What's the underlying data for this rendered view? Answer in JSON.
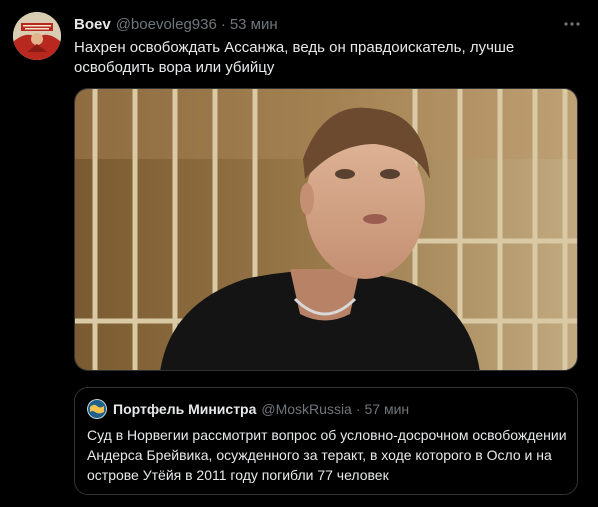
{
  "tweet": {
    "display_name": "Boev",
    "handle": "@boevoleg936",
    "separator": "·",
    "time": "53 мин",
    "text": "Нахрен освобождать Ассанжа, ведь он правдоискатель, лучше освободить вора или убийцу",
    "avatar_icon": "poster-avatar-icon",
    "media_icon": "photo-man-behind-bars"
  },
  "quote": {
    "display_name": "Портфель Министра",
    "handle": "@MoskRussia",
    "separator": "·",
    "time": "57 мин",
    "text": "Суд в Норвегии рассмотрит вопрос об условно-досрочном освобождении Андерса Брейвика, осужденного за теракт, в ходе которого в Осло и на острове Утёйя в 2011 году погибли 77 человек",
    "avatar_icon": "globe-avatar-icon"
  },
  "colors": {
    "background": "#000000",
    "text_primary": "#e7e9ea",
    "text_secondary": "#71767b",
    "border": "#2f3336"
  }
}
